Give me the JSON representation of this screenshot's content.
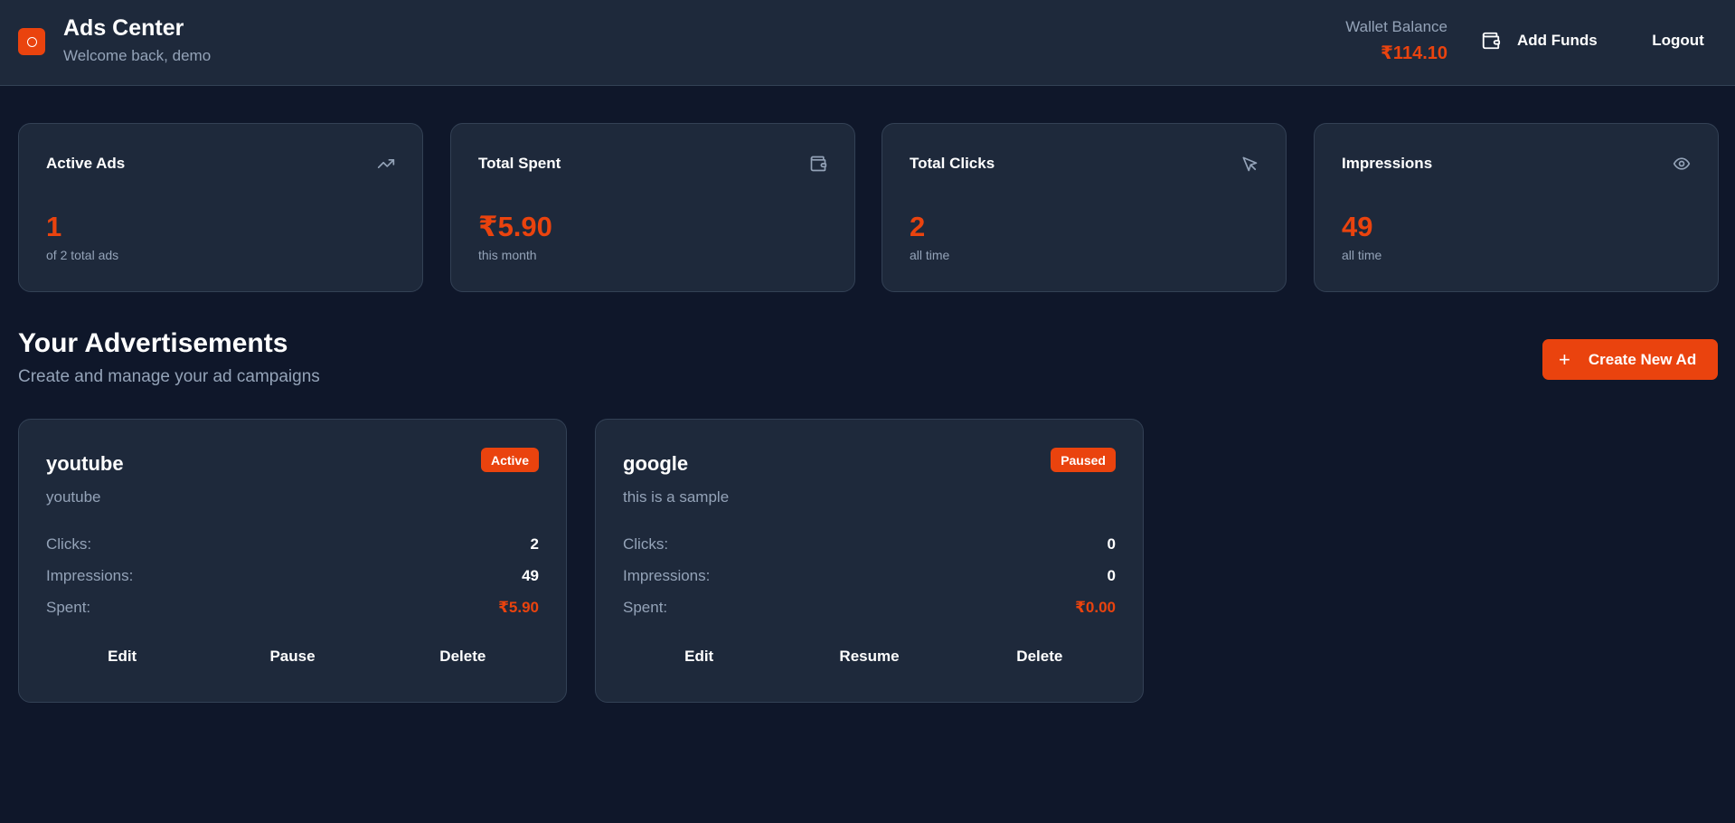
{
  "header": {
    "title": "Ads Center",
    "subtitle": "Welcome back, demo",
    "wallet_label": "Wallet Balance",
    "wallet_value": "₹114.10",
    "add_funds_label": "Add Funds",
    "logout_label": "Logout",
    "accent_color": "#ea430e"
  },
  "stats": [
    {
      "title": "Active Ads",
      "value": "1",
      "sub": "of 2 total ads",
      "icon": "trending-up-icon"
    },
    {
      "title": "Total Spent",
      "value": "₹5.90",
      "sub": "this month",
      "icon": "wallet-icon"
    },
    {
      "title": "Total Clicks",
      "value": "2",
      "sub": "all time",
      "icon": "cursor-icon"
    },
    {
      "title": "Impressions",
      "value": "49",
      "sub": "all time",
      "icon": "eye-icon"
    }
  ],
  "section": {
    "title": "Your Advertisements",
    "subtitle": "Create and manage your ad campaigns",
    "create_label": "Create New Ad",
    "create_icon": "+"
  },
  "ads": [
    {
      "name": "youtube",
      "status": "Active",
      "description": "youtube",
      "clicks_label": "Clicks:",
      "clicks": "2",
      "impressions_label": "Impressions:",
      "impressions": "49",
      "spent_label": "Spent:",
      "spent": "₹5.90",
      "actions": [
        "Edit",
        "Pause",
        "Delete"
      ]
    },
    {
      "name": "google",
      "status": "Paused",
      "description": "this is a sample",
      "clicks_label": "Clicks:",
      "clicks": "0",
      "impressions_label": "Impressions:",
      "impressions": "0",
      "spent_label": "Spent:",
      "spent": "₹0.00",
      "actions": [
        "Edit",
        "Resume",
        "Delete"
      ]
    }
  ]
}
